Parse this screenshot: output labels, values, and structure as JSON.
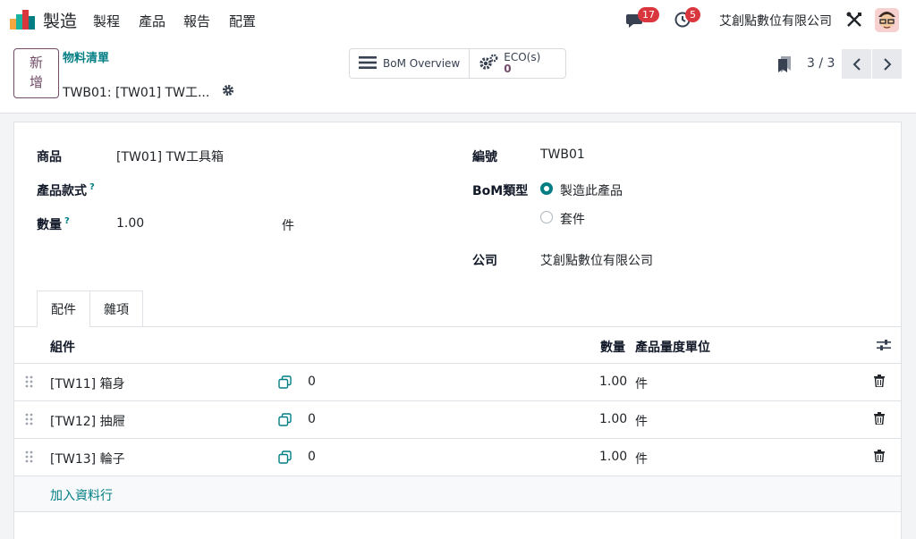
{
  "navbar": {
    "app_name": "製造",
    "menus": [
      "製程",
      "產品",
      "報告",
      "配置"
    ],
    "messages_count": "17",
    "activities_count": "5",
    "company": "艾創點數位有限公司"
  },
  "control": {
    "new_label_1": "新",
    "new_label_2": "增",
    "breadcrumb": "物料清單",
    "record_title": "TWB01: [TW01] TW工...",
    "bom_overview_label": "BoM Overview",
    "eco_label": "ECO(s)",
    "eco_count": "0",
    "pager": "3 / 3"
  },
  "form": {
    "product_label": "商品",
    "product_value": "[TW01] TW工具箱",
    "variant_label": "產品款式",
    "quantity_label": "數量",
    "quantity_value": "1.00",
    "uom_value": "件",
    "help_mark": "?",
    "reference_label": "編號",
    "reference_value": "TWB01",
    "bom_type_label": "BoM類型",
    "bom_type_options": [
      "製造此產品",
      "套件"
    ],
    "bom_type_selected": "製造此產品",
    "company_label": "公司",
    "company_value": "艾創點數位有限公司"
  },
  "tabs": [
    "配件",
    "雜項"
  ],
  "components_table": {
    "headers": {
      "component": "組件",
      "quantity": "數量",
      "uom": "產品量度單位"
    },
    "rows": [
      {
        "component": "[TW11] 箱身",
        "count": "0",
        "quantity": "1.00",
        "uom": "件"
      },
      {
        "component": "[TW12] 抽屜",
        "count": "0",
        "quantity": "1.00",
        "uom": "件"
      },
      {
        "component": "[TW13] 輪子",
        "count": "0",
        "quantity": "1.00",
        "uom": "件"
      }
    ],
    "add_line": "加入資料行"
  },
  "colors": {
    "brand": "#714b67",
    "accent": "#017e84",
    "badge": "#d9363e"
  }
}
